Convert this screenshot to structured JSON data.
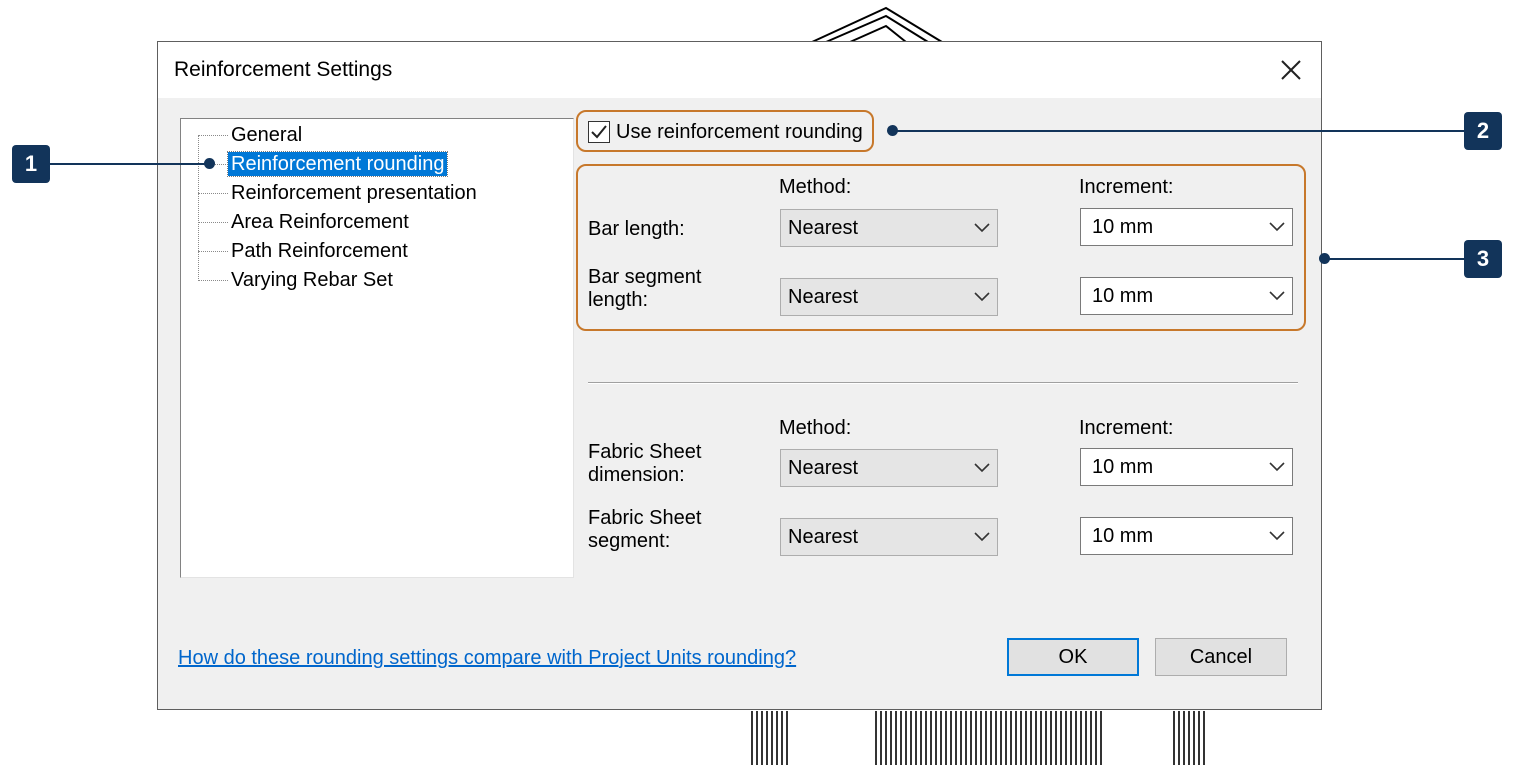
{
  "dialog": {
    "title": "Reinforcement Settings"
  },
  "tree": {
    "items": [
      {
        "label": "General",
        "selected": false
      },
      {
        "label": "Reinforcement rounding",
        "selected": true
      },
      {
        "label": "Reinforcement presentation",
        "selected": false
      },
      {
        "label": "Area Reinforcement",
        "selected": false
      },
      {
        "label": "Path Reinforcement",
        "selected": false
      },
      {
        "label": "Varying Rebar Set",
        "selected": false
      }
    ]
  },
  "rounding": {
    "use_rounding_label": "Use reinforcement rounding",
    "use_rounding_checked": true,
    "bar": {
      "method_header": "Method:",
      "increment_header": "Increment:",
      "rows": [
        {
          "label_line1": "Bar length:",
          "label_line2": "",
          "method": "Nearest",
          "increment": "10 mm"
        },
        {
          "label_line1": "Bar segment",
          "label_line2": "length:",
          "method": "Nearest",
          "increment": "10 mm"
        }
      ]
    },
    "fabric": {
      "method_header": "Method:",
      "increment_header": "Increment:",
      "rows": [
        {
          "label_line1": "Fabric Sheet",
          "label_line2": "dimension:",
          "method": "Nearest",
          "increment": "10 mm"
        },
        {
          "label_line1": "Fabric Sheet",
          "label_line2": "segment:",
          "method": "Nearest",
          "increment": "10 mm"
        }
      ]
    }
  },
  "footer": {
    "help_link": "How do these rounding settings compare with Project Units rounding?",
    "ok_label": "OK",
    "cancel_label": "Cancel"
  },
  "callouts": {
    "one": "1",
    "two": "2",
    "three": "3"
  },
  "colors": {
    "highlight": "#c7782b",
    "callout": "#12345a",
    "selection": "#0078d7",
    "link": "#0066cc"
  }
}
